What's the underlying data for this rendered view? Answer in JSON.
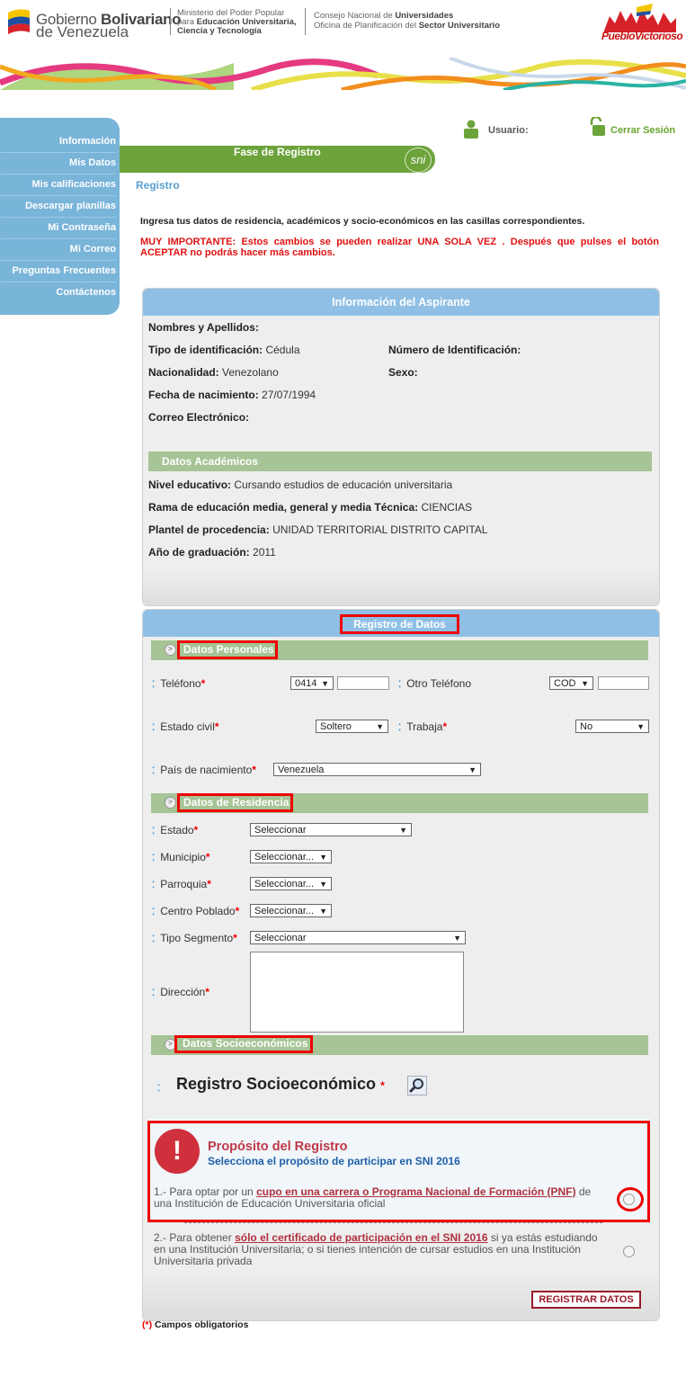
{
  "header": {
    "gov_line1_a": "Gobierno",
    "gov_line1_b": "Bolivariano",
    "gov_line2": "de Venezuela",
    "ministry_1": "Ministerio del Poder Popular",
    "ministry_2a": "para",
    "ministry_2b": "Educación Universitaria,",
    "ministry_3": "Ciencia y Tecnología",
    "council_1a": "Consejo Nacional de",
    "council_1b": "Universidades",
    "council_2a": "Oficina de Planificación del",
    "council_2b": "Sector Universitario",
    "logo_right": "PuebloVictorioso"
  },
  "sidebar": {
    "items": [
      {
        "label": "Información"
      },
      {
        "label": "Mis Datos"
      },
      {
        "label": "Mis calificaciones"
      },
      {
        "label": "Descargar planillas"
      },
      {
        "label": "Mi Contraseña"
      },
      {
        "label": "Mi Correo"
      },
      {
        "label": "Preguntas Frecuentes"
      },
      {
        "label": "Contáctenos"
      }
    ]
  },
  "userbar": {
    "user_label": "Usuario:",
    "logout": "Cerrar Sesión"
  },
  "phase": {
    "title": "Fase de Registro",
    "badge": "sni"
  },
  "breadcrumb": "Registro",
  "intro": "Ingresa tus datos de residencia, académicos y socio-económicos en las casillas correspondientes.",
  "warning": "MUY IMPORTANTE: Estos cambios se pueden realizar UNA SOLA VEZ . Después que pulses el botón ACEPTAR no podrás hacer más cambios.",
  "applicant": {
    "title": "Información del Aspirante",
    "names_label": "Nombres y Apellidos:",
    "id_type_label": "Tipo de identificación:",
    "id_type_value": "Cédula",
    "id_number_label": "Número de Identificación:",
    "nationality_label": "Nacionalidad:",
    "nationality_value": "Venezolano",
    "sex_label": "Sexo:",
    "birth_label": "Fecha de nacimiento:",
    "birth_value": "27/07/1994",
    "email_label": "Correo Electrónico:",
    "academic_title": "Datos Académicos",
    "level_label": "Nivel educativo:",
    "level_value": "Cursando estudios de educación universitaria",
    "branch_label": "Rama de educación media, general y media Técnica:",
    "branch_value": "CIENCIAS",
    "school_label": "Plantel de procedencia:",
    "school_value": "UNIDAD TERRITORIAL DISTRITO CAPITAL",
    "grad_label": "Año de graduación:",
    "grad_value": "2011"
  },
  "form": {
    "title": "Registro de Datos",
    "personal_title": "Datos Personales",
    "phone_label": "Teléfono",
    "phone_code": "0414",
    "other_phone_label": "Otro Teléfono",
    "other_phone_code": "COD",
    "civil_label": "Estado civil",
    "civil_value": "Soltero",
    "works_label": "Trabaja",
    "works_value": "No",
    "country_label": "País de nacimiento",
    "country_value": "Venezuela",
    "residence_title": "Datos de Residencia",
    "state_label": "Estado",
    "state_value": "Seleccionar",
    "municipality_label": "Municipio",
    "municipality_value": "Seleccionar...",
    "parish_label": "Parroquia",
    "parish_value": "Seleccionar...",
    "town_label": "Centro Poblado",
    "town_value": "Seleccionar...",
    "segment_label": "Tipo Segmento",
    "segment_value": "Seleccionar",
    "address_label": "Dirección",
    "socio_title": "Datos Socioeconómicos",
    "socio_register": "Registro Socioeconómico",
    "required_mark": "*"
  },
  "purpose": {
    "title": "Propósito del Registro",
    "subtitle": "Selecciona el propósito de participar en SNI 2016",
    "opt1_pre": "1.- Para optar por un ",
    "opt1_link": "cupo en una carrera o Programa Nacional de Formación (PNF)",
    "opt1_post": " de una Institución de Educación Universitaria oficial",
    "opt2_pre": "2.- Para obtener ",
    "opt2_link": "sólo el certificado de participación en el SNI 2016",
    "opt2_post": " si ya estás estudiando en una Institución Universitaria; o si tienes intención de cursar estudios en una Institución Universitaria privada"
  },
  "submit_label": "REGISTRAR DATOS",
  "footnote_mark": "(*)",
  "footnote": " Campos obligatorios"
}
